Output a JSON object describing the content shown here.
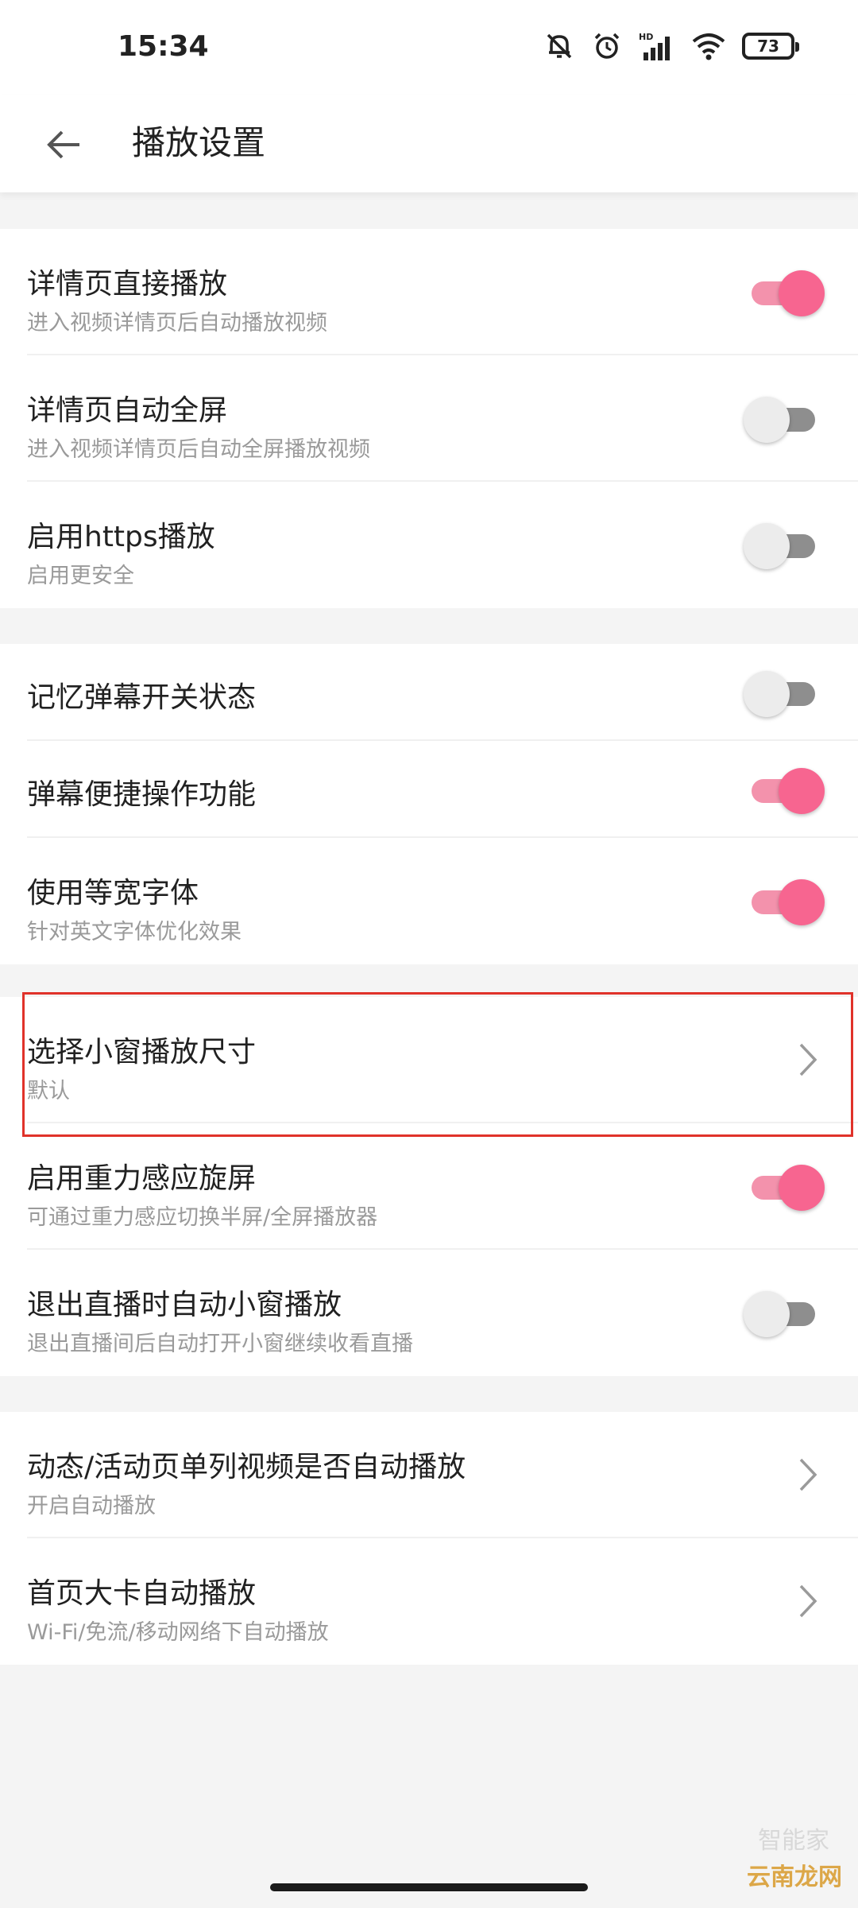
{
  "status_bar": {
    "time": "15:34",
    "battery": "73",
    "icons": [
      "mute-bell-icon",
      "alarm-icon",
      "hd-signal-icon",
      "wifi-icon",
      "battery-icon"
    ]
  },
  "app_bar": {
    "title": "播放设置",
    "back_icon": "arrow-left-icon"
  },
  "colors": {
    "toggle_on_knob": "#f76590",
    "toggle_on_track": "#f392ac",
    "toggle_off_knob": "#ececec",
    "toggle_off_track": "#8e8e8e",
    "highlight": "#e0322a"
  },
  "sections": [
    {
      "items": [
        {
          "title": "详情页直接播放",
          "subtitle": "进入视频详情页后自动播放视频",
          "control": "toggle",
          "on": true
        },
        {
          "title": "详情页自动全屏",
          "subtitle": "进入视频详情页后自动全屏播放视频",
          "control": "toggle",
          "on": false
        },
        {
          "title": "启用https播放",
          "subtitle": "启用更安全",
          "control": "toggle",
          "on": false
        }
      ]
    },
    {
      "items": [
        {
          "title": "记忆弹幕开关状态",
          "control": "toggle",
          "on": false
        },
        {
          "title": "弹幕便捷操作功能",
          "control": "toggle",
          "on": true
        },
        {
          "title": "使用等宽字体",
          "subtitle": "针对英文字体优化效果",
          "control": "toggle",
          "on": true
        }
      ]
    },
    {
      "items": [
        {
          "title": "选择小窗播放尺寸",
          "subtitle": "默认",
          "control": "chevron",
          "highlighted": true
        },
        {
          "title": "启用重力感应旋屏",
          "subtitle": "可通过重力感应切换半屏/全屏播放器",
          "control": "toggle",
          "on": true
        },
        {
          "title": "退出直播时自动小窗播放",
          "subtitle": "退出直播间后自动打开小窗继续收看直播",
          "control": "toggle",
          "on": false
        }
      ]
    },
    {
      "items": [
        {
          "title": "动态/活动页单列视频是否自动播放",
          "subtitle": "开启自动播放",
          "control": "chevron"
        },
        {
          "title": "首页大卡自动播放",
          "subtitle": "Wi-Fi/免流/移动网络下自动播放",
          "control": "chevron"
        }
      ]
    }
  ],
  "watermark": {
    "text": "云南龙网",
    "faint": "智能家"
  }
}
